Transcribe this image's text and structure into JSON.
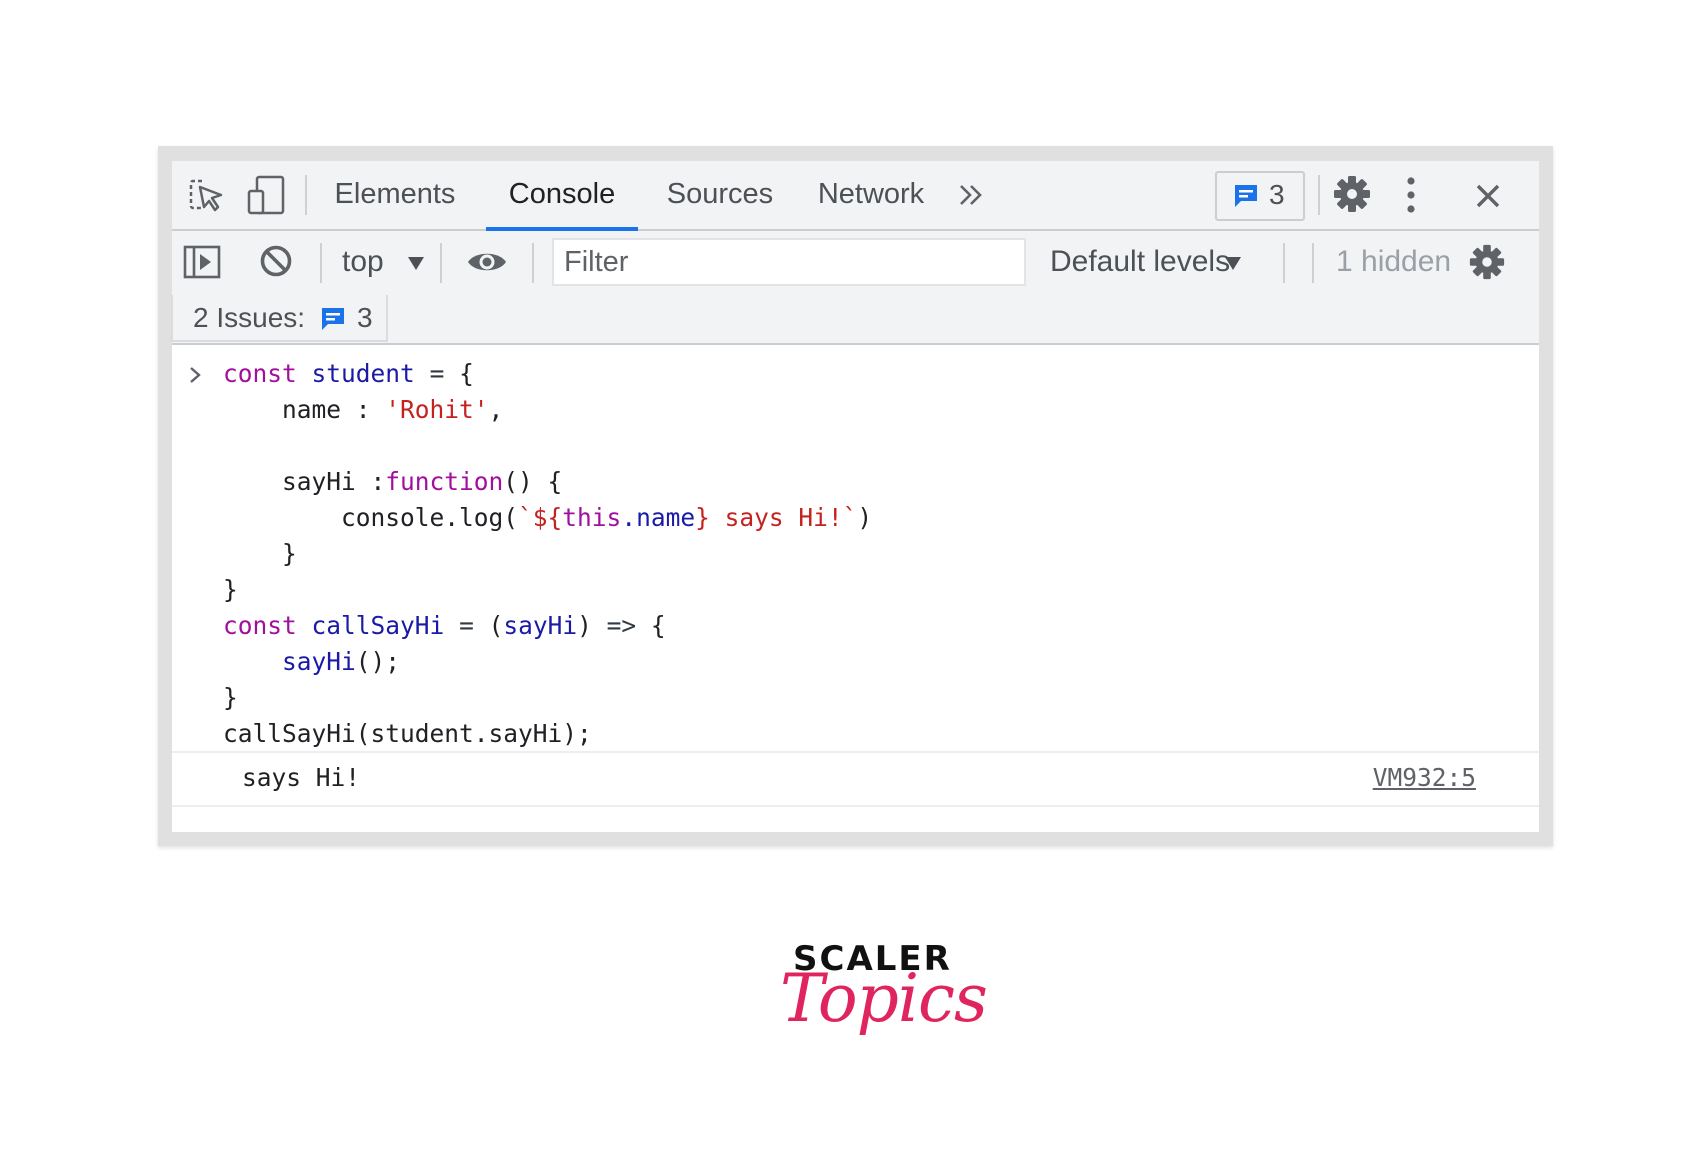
{
  "tabs": [
    {
      "label": "Elements"
    },
    {
      "label": "Console"
    },
    {
      "label": "Sources"
    },
    {
      "label": "Network"
    }
  ],
  "active_tab": "Console",
  "issues_badge_count": "3",
  "toolbar": {
    "context": "top",
    "filter_placeholder": "Filter",
    "levels": "Default levels",
    "hidden": "1 hidden"
  },
  "issues_bar": {
    "label": "2 Issues:",
    "count": "3"
  },
  "console": {
    "code_lines": [
      "const student = {",
      "    name : 'Rohit',",
      "",
      "    sayHi :function() {",
      "        console.log(`${this.name} says Hi!`)",
      "    }",
      "}",
      "const callSayHi = (sayHi) => {",
      "    sayHi();",
      "}",
      "callSayHi(student.sayHi);"
    ],
    "output": {
      "text": "says Hi!",
      "source": "VM932:5"
    }
  },
  "brand": {
    "word": "SCALER",
    "script": "Topics",
    "script_color": "#e0245e"
  },
  "colors": {
    "accent": "#1a73e8",
    "keyword": "#a10f9e",
    "variable": "#1a1aa6",
    "string": "#c5221f"
  },
  "icons": [
    "inspect-element-icon",
    "device-toolbar-icon",
    "more-tabs-icon",
    "issues-icon",
    "settings-icon",
    "kebab-menu-icon",
    "close-icon",
    "sidebar-toggle-icon",
    "clear-console-icon",
    "live-expression-icon",
    "dropdown-caret-icon",
    "console-settings-icon",
    "prompt-chevron-icon"
  ]
}
